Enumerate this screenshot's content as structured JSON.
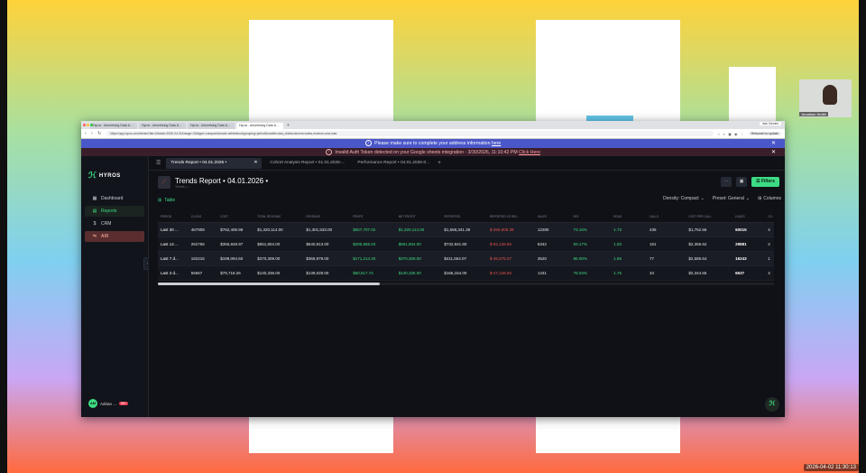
{
  "camera": {
    "name": "Jonathan Smith"
  },
  "clock": "2026-04-02 11:30:13",
  "browser": {
    "tabs": [
      {
        "label": "Hyros - Advertising Data &..."
      },
      {
        "label": "Hyros - Advertising Data &..."
      },
      {
        "label": "Hyros - Advertising Data &..."
      },
      {
        "label": "Hyros - Advertising Data &..."
      }
    ],
    "tab_right": "Ask Gemini",
    "url": "https://app.hyros.com/trends?tab=0&date=2026-04-01&range=30&type=compare&mode=attribution&grouping=period&models=last_click&columns=sales,revenue,cost,roas",
    "relaunch_label": "Relaunch to update"
  },
  "banners": {
    "address_text": "Please make sure to complete your address information",
    "address_link": "here",
    "token_text": "Invalid Auth Token detected on your Google sheets integration - 3/30/2026, 11:10:42 PM",
    "token_link": "Click Here"
  },
  "sidebar": {
    "logo": "HYROS",
    "items": [
      {
        "label": "Dashboard",
        "icon": "grid-icon"
      },
      {
        "label": "Reports",
        "icon": "reports-icon"
      },
      {
        "label": "CRM",
        "icon": "dollar-icon"
      },
      {
        "label": "AIR",
        "icon": "air-icon"
      }
    ],
    "user_initials": "AM",
    "user_name": "Adrian ...",
    "badge": "99+"
  },
  "doc_tabs": [
    {
      "label": "Trends Report • 04.01.2026 •"
    },
    {
      "label": "Cohort Analysis Report • 01.01.2026-..."
    },
    {
      "label": "Performance Report • 04.01.2026-0..."
    }
  ],
  "report": {
    "title": "Trends Report • 04.01.2026 •",
    "subtitle": "Trends | ..."
  },
  "toolbar": {
    "filters_label": "Filters",
    "table_label": "Table",
    "density": "Density: Compact",
    "preset": "Preset: General",
    "columns": "Columns"
  },
  "table": {
    "headers": [
      "PERIOD",
      "CLICKS",
      "COST",
      "TOTAL REVENUE",
      "REVENUE",
      "PROFIT",
      "NET PROFIT",
      "REPORTED",
      "REPORTED VS REV...",
      "SALES",
      "ROI",
      "ROAS",
      "CALLS",
      "COST PER CALL",
      "LEADS",
      "CO..."
    ],
    "rows": [
      [
        "Last 30 ...",
        "467908",
        "$762,406.98",
        "$1,320,114.00",
        "$1,301,533.00",
        "$557,707.02",
        "$1,320,114.00",
        "$1,558,341.39",
        "$-256,808.39",
        "12280",
        "73.16%",
        "1.73",
        "435",
        "$1,752.66",
        "60015",
        "4"
      ],
      [
        "Last 14 ...",
        "262766",
        "$355,848.97",
        "$651,804.00",
        "$640,813.00",
        "$295,955.03",
        "$651,804.00",
        "$732,941.80",
        "$-92,128.80",
        "6342",
        "83.17%",
        "1.83",
        "151",
        "$2,356.62",
        "29881",
        "2"
      ],
      [
        "Last 7 d...",
        "162215",
        "$199,094.60",
        "$370,309.00",
        "$365,979.00",
        "$171,214.40",
        "$370,309.00",
        "$411,554.07",
        "$-45,575.07",
        "3520",
        "86.00%",
        "1.86",
        "77",
        "$2,585.64",
        "16243",
        "1"
      ],
      [
        "Last 3 d...",
        "55667",
        "$79,718.26",
        "$140,336.00",
        "$139,028.00",
        "$60,617.74",
        "$140,336.00",
        "$166,154.00",
        "$-27,126.00",
        "1431",
        "76.04%",
        "1.76",
        "34",
        "$2,344.65",
        "6537",
        "4"
      ]
    ]
  },
  "colors": {
    "accent": "#3ddc84",
    "negative": "#e8534f",
    "banner_info": "#4a57c9",
    "banner_error": "#3a1f2b"
  }
}
